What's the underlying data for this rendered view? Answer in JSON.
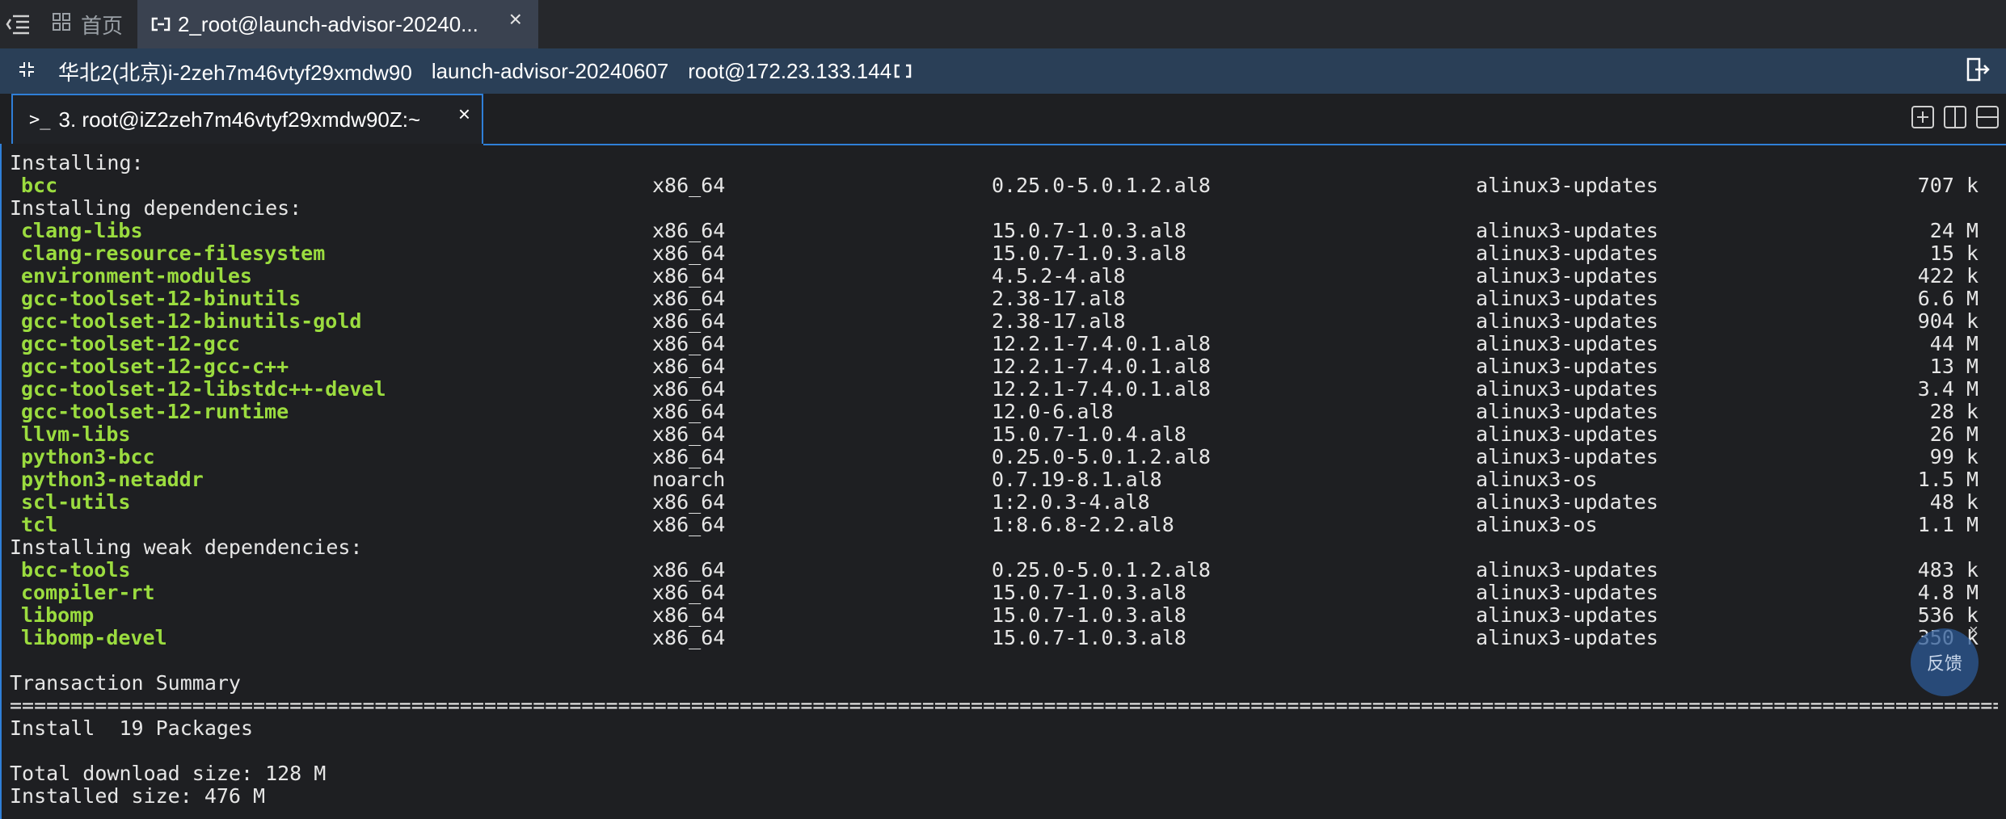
{
  "tabbar": {
    "home_label": "首页",
    "active_tab_title": "2_root@launch-advisor-20240...",
    "close_glyph": "×"
  },
  "infobar": {
    "region_instance": "华北2(北京)i-2zeh7m46vtyf29xmdw90",
    "instance_name": "launch-advisor-20240607",
    "user_host": "root@172.23.133.144"
  },
  "terminal_tab": {
    "prompt_glyph": ">_",
    "title": "3. root@iZ2zeh7m46vtyf29xmdw90Z:~",
    "close_glyph": "×"
  },
  "terminal": {
    "installing_header": "Installing:",
    "installing": [
      {
        "name": "bcc",
        "arch": "x86_64",
        "version": "0.25.0-5.0.1.2.al8",
        "repo": "alinux3-updates",
        "size": "707 k"
      }
    ],
    "deps_header": "Installing dependencies:",
    "dependencies": [
      {
        "name": "clang-libs",
        "arch": "x86_64",
        "version": "15.0.7-1.0.3.al8",
        "repo": "alinux3-updates",
        "size": "24 M"
      },
      {
        "name": "clang-resource-filesystem",
        "arch": "x86_64",
        "version": "15.0.7-1.0.3.al8",
        "repo": "alinux3-updates",
        "size": "15 k"
      },
      {
        "name": "environment-modules",
        "arch": "x86_64",
        "version": "4.5.2-4.al8",
        "repo": "alinux3-updates",
        "size": "422 k"
      },
      {
        "name": "gcc-toolset-12-binutils",
        "arch": "x86_64",
        "version": "2.38-17.al8",
        "repo": "alinux3-updates",
        "size": "6.6 M"
      },
      {
        "name": "gcc-toolset-12-binutils-gold",
        "arch": "x86_64",
        "version": "2.38-17.al8",
        "repo": "alinux3-updates",
        "size": "904 k"
      },
      {
        "name": "gcc-toolset-12-gcc",
        "arch": "x86_64",
        "version": "12.2.1-7.4.0.1.al8",
        "repo": "alinux3-updates",
        "size": "44 M"
      },
      {
        "name": "gcc-toolset-12-gcc-c++",
        "arch": "x86_64",
        "version": "12.2.1-7.4.0.1.al8",
        "repo": "alinux3-updates",
        "size": "13 M"
      },
      {
        "name": "gcc-toolset-12-libstdc++-devel",
        "arch": "x86_64",
        "version": "12.2.1-7.4.0.1.al8",
        "repo": "alinux3-updates",
        "size": "3.4 M"
      },
      {
        "name": "gcc-toolset-12-runtime",
        "arch": "x86_64",
        "version": "12.0-6.al8",
        "repo": "alinux3-updates",
        "size": "28 k"
      },
      {
        "name": "llvm-libs",
        "arch": "x86_64",
        "version": "15.0.7-1.0.4.al8",
        "repo": "alinux3-updates",
        "size": "26 M"
      },
      {
        "name": "python3-bcc",
        "arch": "x86_64",
        "version": "0.25.0-5.0.1.2.al8",
        "repo": "alinux3-updates",
        "size": "99 k"
      },
      {
        "name": "python3-netaddr",
        "arch": "noarch",
        "version": "0.7.19-8.1.al8",
        "repo": "alinux3-os",
        "size": "1.5 M"
      },
      {
        "name": "scl-utils",
        "arch": "x86_64",
        "version": "1:2.0.3-4.al8",
        "repo": "alinux3-updates",
        "size": "48 k"
      },
      {
        "name": "tcl",
        "arch": "x86_64",
        "version": "1:8.6.8-2.2.al8",
        "repo": "alinux3-os",
        "size": "1.1 M"
      }
    ],
    "weak_header": "Installing weak dependencies:",
    "weak_dependencies": [
      {
        "name": "bcc-tools",
        "arch": "x86_64",
        "version": "0.25.0-5.0.1.2.al8",
        "repo": "alinux3-updates",
        "size": "483 k"
      },
      {
        "name": "compiler-rt",
        "arch": "x86_64",
        "version": "15.0.7-1.0.3.al8",
        "repo": "alinux3-updates",
        "size": "4.8 M"
      },
      {
        "name": "libomp",
        "arch": "x86_64",
        "version": "15.0.7-1.0.3.al8",
        "repo": "alinux3-updates",
        "size": "536 k"
      },
      {
        "name": "libomp-devel",
        "arch": "x86_64",
        "version": "15.0.7-1.0.3.al8",
        "repo": "alinux3-updates",
        "size": "350 k"
      }
    ],
    "summary_header": "Transaction Summary",
    "separator": "=================================================================================================================================================================================================================================================================================",
    "install_line": "Install  19 Packages",
    "download_size": "Total download size: 128 M",
    "installed_size": "Installed size: 476 M"
  },
  "feedback": {
    "label": "反馈",
    "close_glyph": "×"
  },
  "colors": {
    "package_name": "#9bdc3f",
    "accent_border": "#2f7fd8",
    "info_bar": "#2a3f57"
  }
}
